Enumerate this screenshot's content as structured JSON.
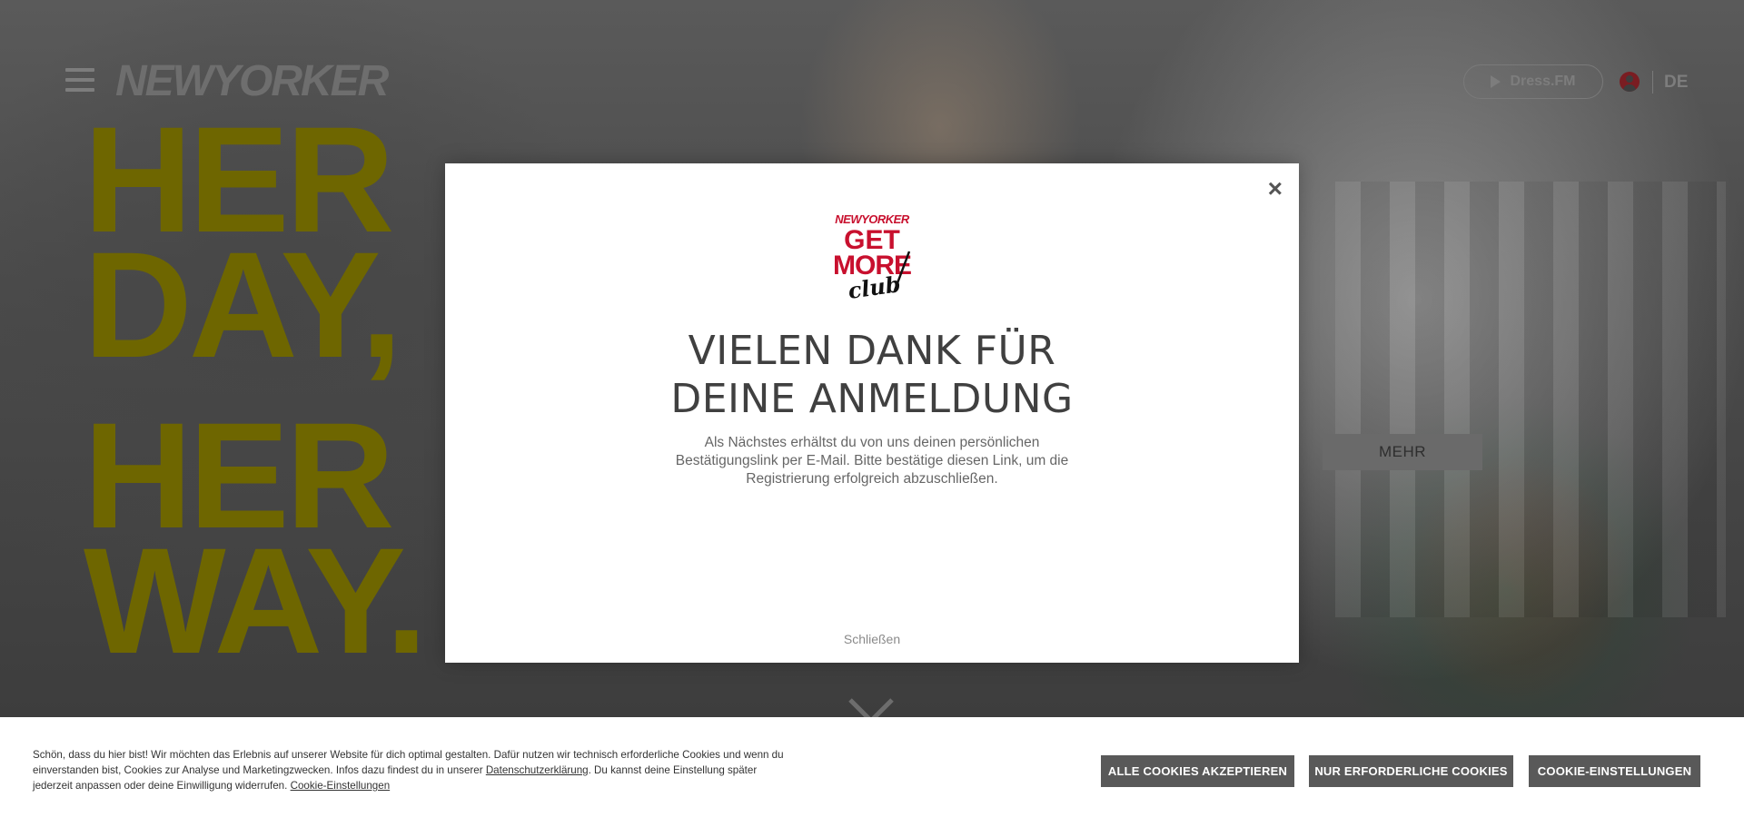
{
  "header": {
    "logo_text": "NEWYORKER",
    "dressfm_label": "Dress.FM",
    "language": "DE"
  },
  "hero": {
    "headline_lines": [
      "HER",
      "DAY,",
      "HER",
      "WAY."
    ],
    "cta_label": "MEHR"
  },
  "modal": {
    "logo_brand": "NEWYORKER",
    "logo_line1": "GET",
    "logo_line2": "MORE",
    "logo_script": "club",
    "title_line1": "VIELEN DANK FÜR",
    "title_line2": "DEINE ANMELDUNG",
    "body": "Als Nächstes erhältst du von uns deinen persönlichen Bestätigungslink per E-Mail. Bitte bestätige diesen Link, um die Registrierung erfolgreich abzuschließen.",
    "close_label": "Schließen",
    "close_symbol": "×"
  },
  "cookie": {
    "text_part1": "Schön, dass du hier bist! Wir möchten das Erlebnis auf unserer Website für dich optimal gestalten. Dafür nutzen wir technisch erforderliche Cookies und wenn du einverstanden bist, Cookies zur Analyse und Marketingzwecken. Infos dazu findest du in unserer ",
    "privacy_link": "Datenschutzerklärung",
    "text_part2": ". Du kannst deine Einstellung später jederzeit anpassen oder deine Einwilligung widerrufen. ",
    "settings_link": "Cookie-Einstellungen",
    "accept_all": "ALLE COOKIES AKZEPTIEREN",
    "only_required": "NUR ERFORDERLICHE COOKIES",
    "settings_button": "COOKIE-EINSTELLUNGEN"
  },
  "colors": {
    "headline": "#6e6600",
    "brand_red": "#c8102e",
    "cookie_button": "#595959"
  },
  "icons": [
    "menu-icon",
    "play-icon",
    "user-icon",
    "close-icon",
    "chevron-down-icon"
  ]
}
